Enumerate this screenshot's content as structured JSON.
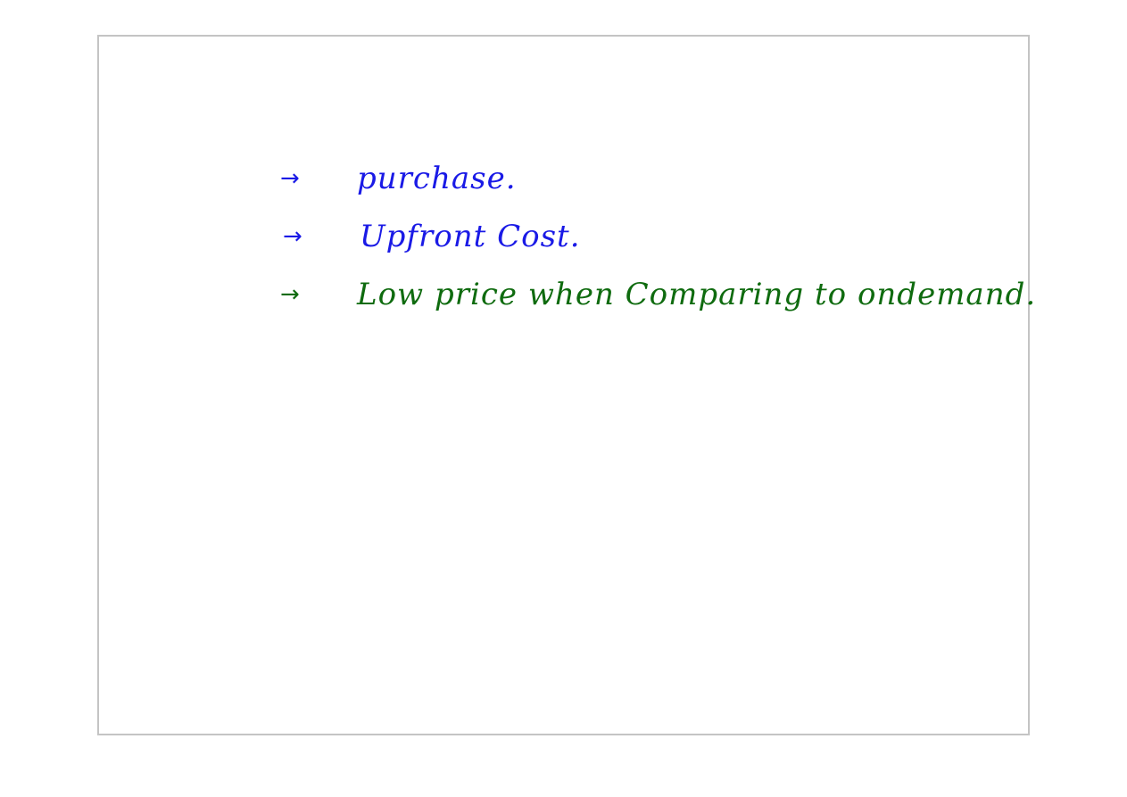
{
  "colors": {
    "blue_ink": "#1a1ae6",
    "green_ink": "#0f6b0f",
    "page_border": "#c4c4c4"
  },
  "notes": [
    {
      "bullet": "→",
      "text": "purchase.",
      "ink": "blue"
    },
    {
      "bullet": "→",
      "text": "Upfront Cost.",
      "ink": "blue"
    },
    {
      "bullet": "→",
      "text": "Low price when Comparing to ondemand.",
      "ink": "green"
    }
  ]
}
